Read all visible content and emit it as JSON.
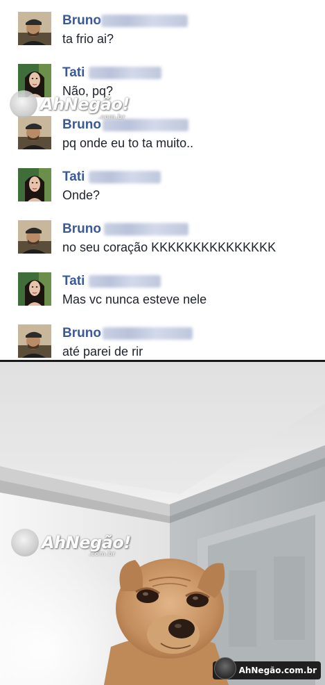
{
  "messages": [
    {
      "sender": "Bruno",
      "text": "ta frio ai?",
      "avatar": "bruno-avatar"
    },
    {
      "sender": "Tati",
      "text": "Não, pq?",
      "avatar": "tati-avatar"
    },
    {
      "sender": "Bruno",
      "text": "pq onde eu to ta muito..",
      "avatar": "bruno-avatar"
    },
    {
      "sender": "Tati",
      "text": "Onde?",
      "avatar": "tati-avatar"
    },
    {
      "sender": "Bruno",
      "text": "no seu coração KKKKKKKKKKKKKKK",
      "avatar": "bruno-avatar"
    },
    {
      "sender": "Tati",
      "text": "Mas vc nunca esteve nele",
      "avatar": "tati-avatar"
    },
    {
      "sender": "Bruno",
      "text": "até parei de rir",
      "avatar": "bruno-avatar"
    }
  ],
  "watermark": {
    "text": "AhNegão!",
    "sub": ".com.br",
    "badge": "AhNegão.com.br"
  },
  "colors": {
    "name": "#3b5998",
    "text": "#1d2129",
    "divider": "#1a1a1a"
  },
  "photo": {
    "subject": "chihuahua-dog-photo"
  }
}
